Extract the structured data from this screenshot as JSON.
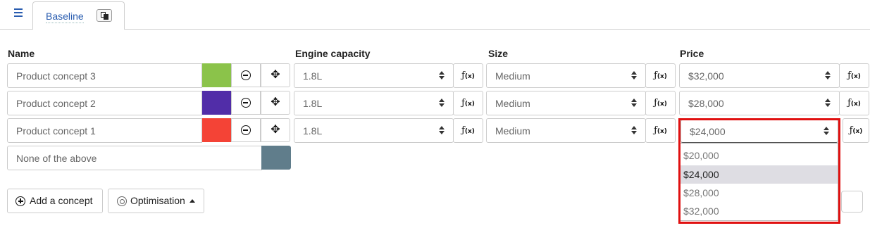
{
  "tabs": [
    {
      "label": "Baseline"
    }
  ],
  "headers": {
    "name": "Name",
    "engine": "Engine capacity",
    "size": "Size",
    "price": "Price"
  },
  "rows": [
    {
      "name": "Product concept 3",
      "color": "#8bc34a",
      "engine": "1.8L",
      "size": "Medium",
      "price": "$32,000"
    },
    {
      "name": "Product concept 2",
      "color": "#512da8",
      "engine": "1.8L",
      "size": "Medium",
      "price": "$28,000"
    },
    {
      "name": "Product concept 1",
      "color": "#f44336",
      "engine": "1.8L",
      "size": "Medium",
      "price": "$24,000"
    }
  ],
  "none_option": {
    "label": "None of the above",
    "color": "#607d8b"
  },
  "fx_label": "ƒ",
  "fx_sub": "(x)",
  "buttons": {
    "add_concept": "Add a concept",
    "optimisation": "Optimisation"
  },
  "price_dropdown": {
    "options": [
      "$20,000",
      "$24,000",
      "$28,000",
      "$32,000"
    ],
    "selected": "$24,000"
  },
  "icons": {
    "menu": "hamburger-icon",
    "copy": "copy-icon",
    "remove": "minus-circle-icon",
    "move": "move-icon",
    "add": "plus-circle-icon",
    "optimise": "target-icon",
    "caret": "caret-up-icon"
  }
}
